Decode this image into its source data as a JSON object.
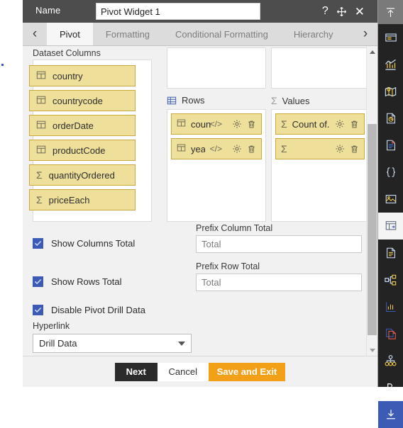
{
  "window": {
    "name_label": "Name",
    "name_value": "Pivot Widget 1",
    "controls": [
      {
        "name": "help-icon",
        "glyph": "?"
      },
      {
        "name": "move-icon",
        "glyph": "move"
      },
      {
        "name": "close-icon",
        "glyph": "✕"
      }
    ]
  },
  "tabs": {
    "prev_label": "‹",
    "next_label": "›",
    "items": [
      {
        "label": "Pivot",
        "active": true
      },
      {
        "label": "Formatting",
        "active": false
      },
      {
        "label": "Conditional Formatting",
        "active": false
      },
      {
        "label": "Hierarchy",
        "active": false
      }
    ]
  },
  "dataset": {
    "label": "Dataset Columns",
    "columns": [
      {
        "name": "country",
        "type": "dimension"
      },
      {
        "name": "countrycode",
        "type": "dimension"
      },
      {
        "name": "orderDate",
        "type": "dimension"
      },
      {
        "name": "productCode",
        "type": "dimension"
      },
      {
        "name": "quantityOrdered",
        "type": "measure"
      },
      {
        "name": "priceEach",
        "type": "measure"
      }
    ]
  },
  "zones": {
    "rows": {
      "label": "Rows",
      "chips": [
        {
          "name": "country",
          "code_badge": "</>",
          "has_settings": true,
          "has_delete": true
        },
        {
          "name": "year",
          "code_badge": "</>",
          "has_settings": true,
          "has_delete": true
        }
      ]
    },
    "values": {
      "label": "Values",
      "chips": [
        {
          "name": "Count of..",
          "has_settings": true,
          "has_delete": true
        },
        {
          "name": "",
          "has_settings": true,
          "has_delete": true
        }
      ]
    }
  },
  "options": {
    "show_columns_total": {
      "label": "Show Columns Total",
      "checked": true
    },
    "show_rows_total": {
      "label": "Show Rows Total",
      "checked": true
    },
    "disable_pivot_drill": {
      "label": "Disable Pivot Drill Data",
      "checked": true
    },
    "prefix_column_total": {
      "label": "Prefix Column Total",
      "value": "",
      "placeholder": "Total"
    },
    "prefix_row_total": {
      "label": "Prefix Row Total",
      "value": "",
      "placeholder": "Total"
    },
    "hyperlink": {
      "label": "Hyperlink",
      "value": "Drill Data"
    }
  },
  "footer": {
    "next": "Next",
    "cancel": "Cancel",
    "save_and_exit": "Save and Exit"
  },
  "rail": {
    "items": [
      {
        "name": "collapse-up-icon",
        "state": "top-active"
      },
      {
        "name": "window-panel-icon",
        "state": "normal"
      },
      {
        "name": "chart-bar-icon",
        "state": "normal"
      },
      {
        "name": "map-pin-icon",
        "state": "normal"
      },
      {
        "name": "document-chart-icon",
        "state": "normal"
      },
      {
        "name": "text-document-icon",
        "state": "normal"
      },
      {
        "name": "code-braces-icon",
        "state": "normal"
      },
      {
        "name": "image-icon",
        "state": "normal"
      },
      {
        "name": "pivot-table-icon",
        "state": "selected"
      },
      {
        "name": "report-document-icon",
        "state": "normal"
      },
      {
        "name": "tree-hierarchy-icon",
        "state": "normal"
      },
      {
        "name": "line-chart-icon",
        "state": "normal"
      },
      {
        "name": "copy-pages-icon",
        "state": "normal"
      },
      {
        "name": "org-chart-icon",
        "state": "normal"
      },
      {
        "name": "prescription-rx-icon",
        "state": "normal"
      },
      {
        "name": "download-icon",
        "state": "blue"
      }
    ]
  },
  "colors": {
    "chip_fill": "#eedf9a",
    "chip_border": "#c8a93a",
    "accent_orange": "#f3a019",
    "checkbox_blue": "#3b5bb5",
    "titlebar": "#4d4d4d"
  }
}
